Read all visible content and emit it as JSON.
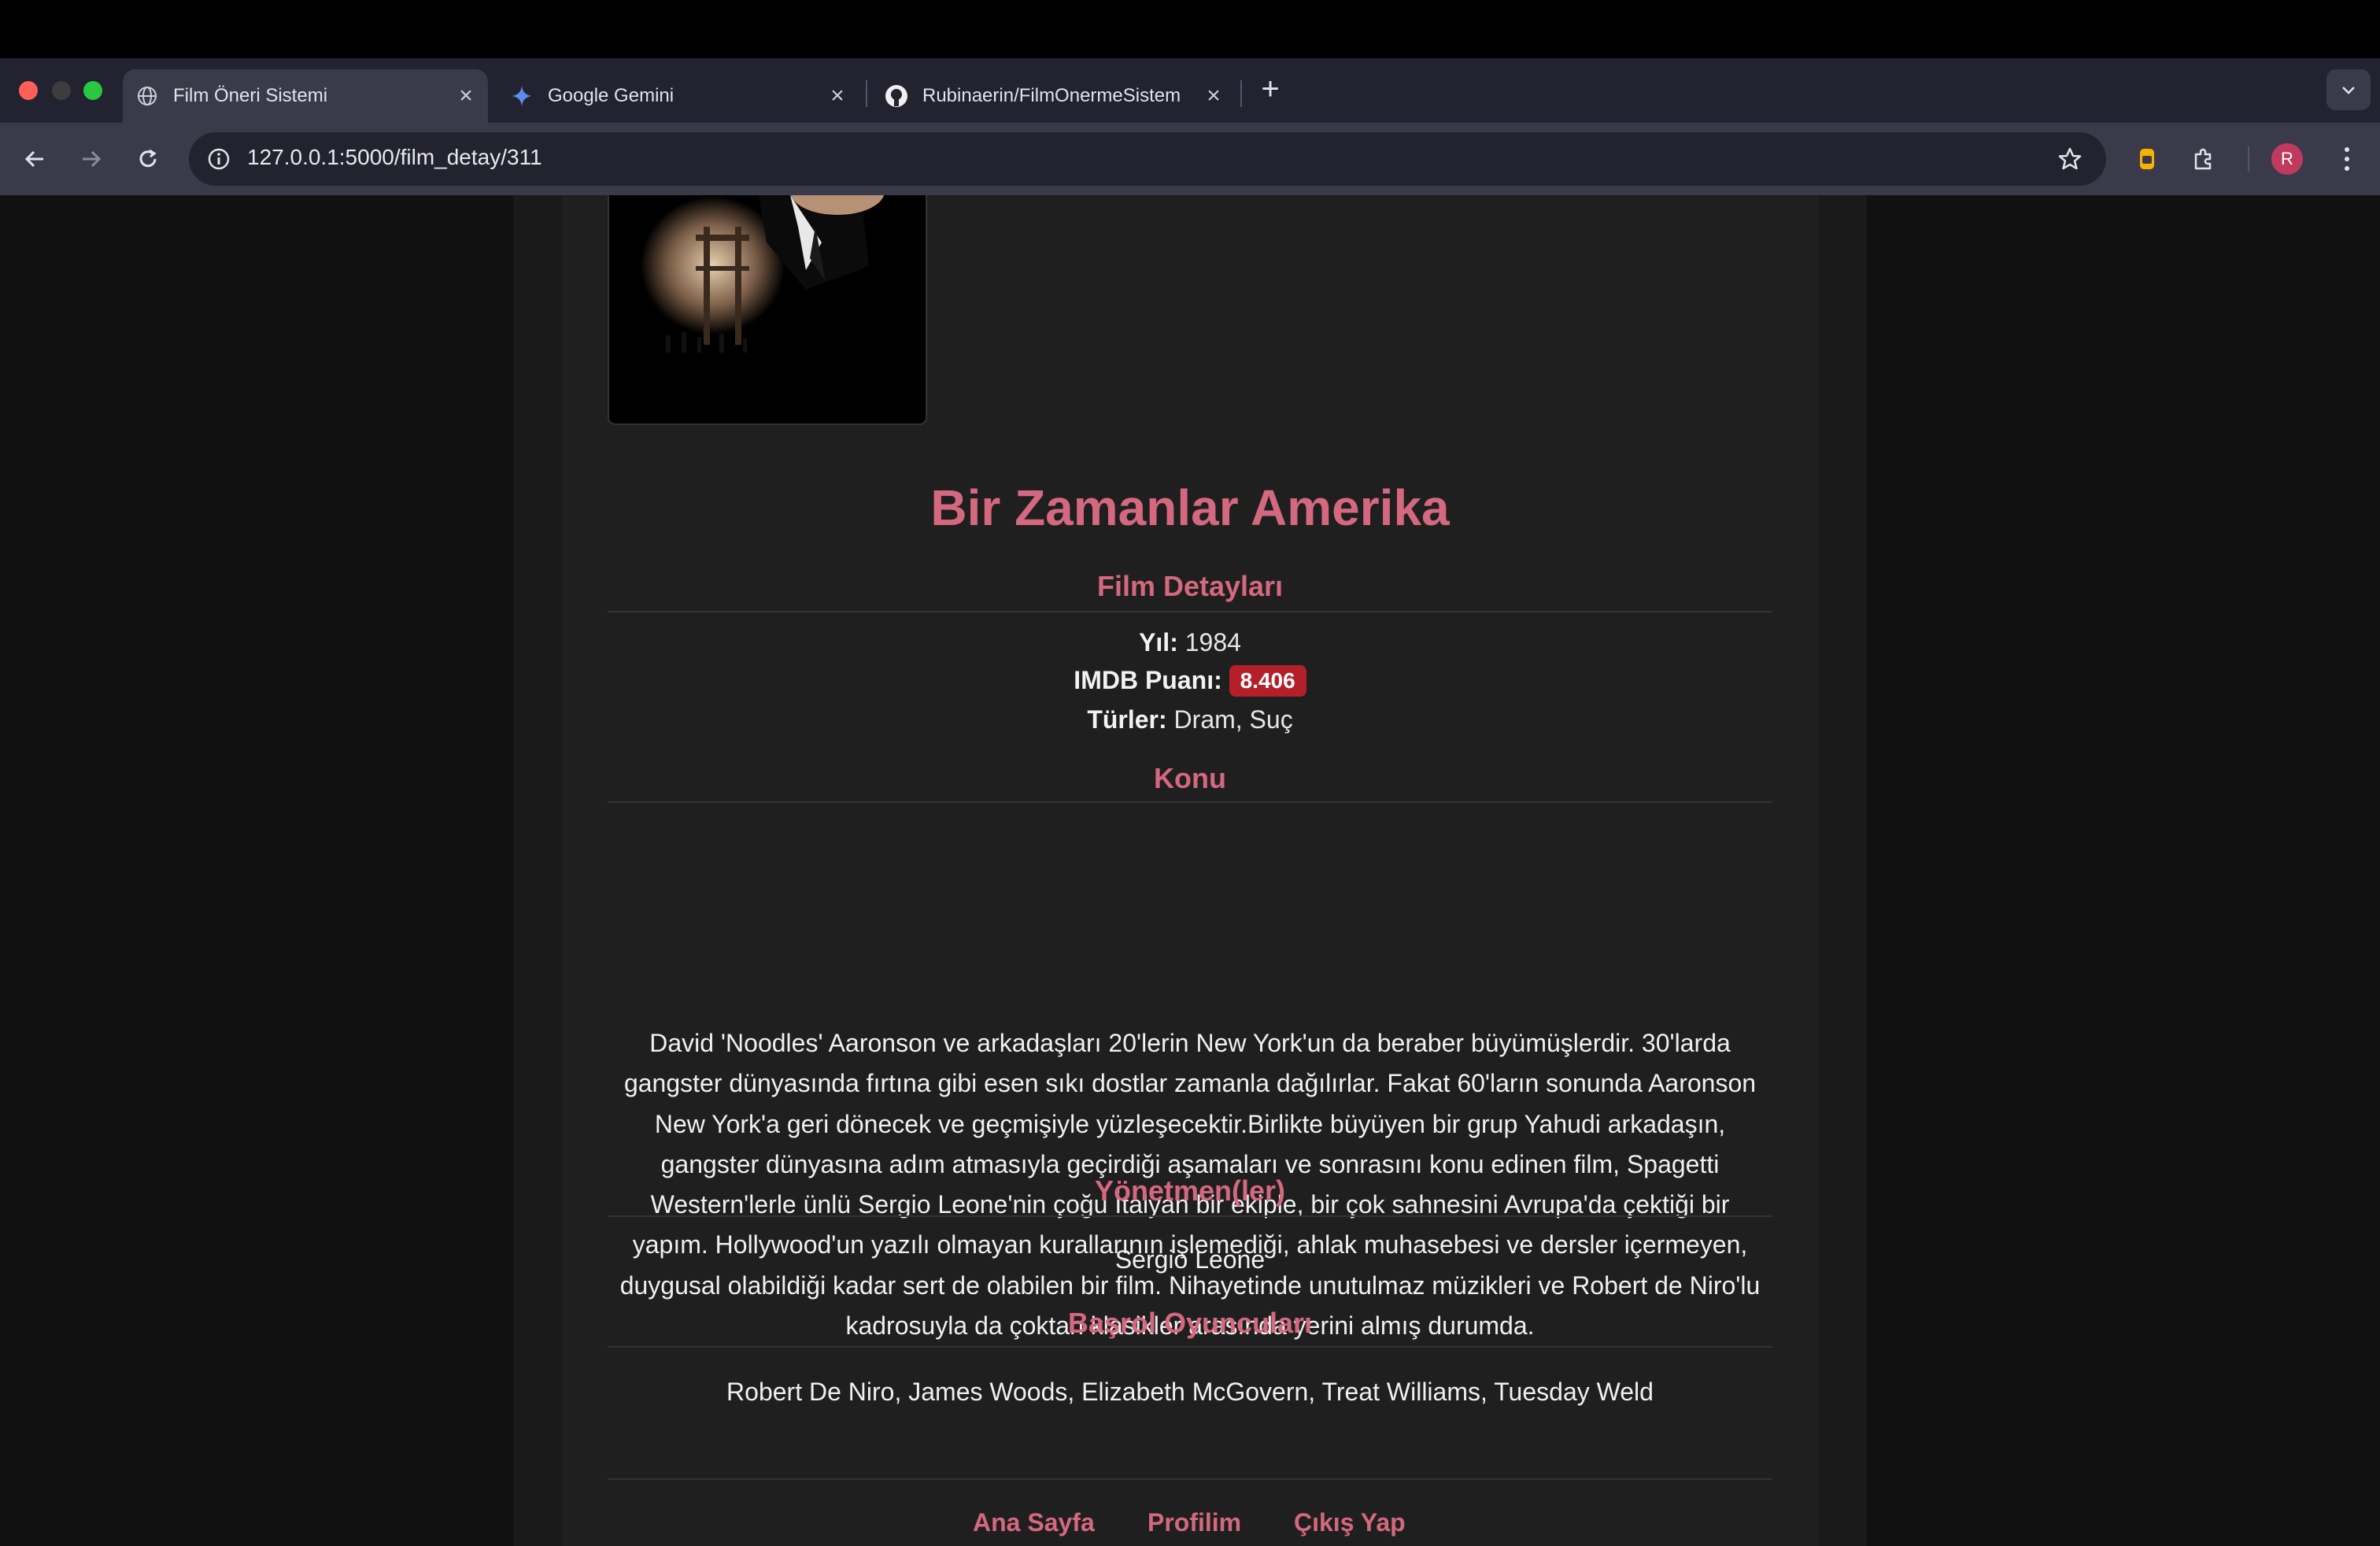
{
  "browser": {
    "tabs": [
      {
        "title": "Film Öneri Sistemi",
        "icon": "globe-icon",
        "active": true
      },
      {
        "title": "Google Gemini",
        "icon": "gemini-icon",
        "active": false
      },
      {
        "title": "Rubinaerin/FilmOnermeSistem",
        "icon": "github-icon",
        "active": false
      }
    ],
    "url": "127.0.0.1:5000/film_detay/311",
    "profile_initial": "R",
    "colors": {
      "close": "#ff5f57",
      "minimize": "#3d3d3d",
      "maximize": "#28c840",
      "accent": "#d4687e",
      "badge": "#b3202a"
    }
  },
  "movie": {
    "title": "Bir Zamanlar Amerika",
    "details_heading": "Film Detayları",
    "year_label": "Yıl:",
    "year": "1984",
    "imdb_label": "IMDB Puanı:",
    "imdb": "8.406",
    "genres_label": "Türler:",
    "genres": "Dram, Suç",
    "plot_heading": "Konu",
    "plot_lines": [
      "David 'Noodles' Aaronson ve arkadaşları 20'lerin New York'un da beraber büyümüşlerdir. 30'larda",
      "gangster dünyasında fırtına gibi esen sıkı dostlar zamanla dağılırlar. Fakat 60'ların sonunda Aaronson",
      "New York'a geri dönecek ve geçmişiyle yüzleşecektir.Birlikte büyüyen bir grup Yahudi arkadaşın,",
      "gangster dünyasına adım atmasıyla geçirdiği aşamaları ve sonrasını konu edinen film, Spagetti",
      "Western'lerle ünlü Sergio Leone'nin çoğu İtalyan bir ekiple, bir çok sahnesini Avrupa'da çektiği bir",
      "yapım. Hollywood'un yazılı olmayan kurallarının işlemediği, ahlak muhasebesi ve dersler içermeyen,",
      "duygusal olabildiği kadar sert de olabilen bir film. Nihayetinde unutulmaz müzikleri ve Robert de Niro'lu",
      "kadrosuyla da çoktan klasikler arasında yerini almış durumda."
    ],
    "directors_heading": "Yönetmen(ler)",
    "directors": "Sergio Leone",
    "cast_heading": "Başrol Oyuncuları",
    "cast": "Robert De Niro, James Woods, Elizabeth McGovern, Treat Williams, Tuesday Weld"
  },
  "footer": {
    "links": [
      "Ana Sayfa",
      "Profilim",
      "Çıkış Yap"
    ]
  }
}
